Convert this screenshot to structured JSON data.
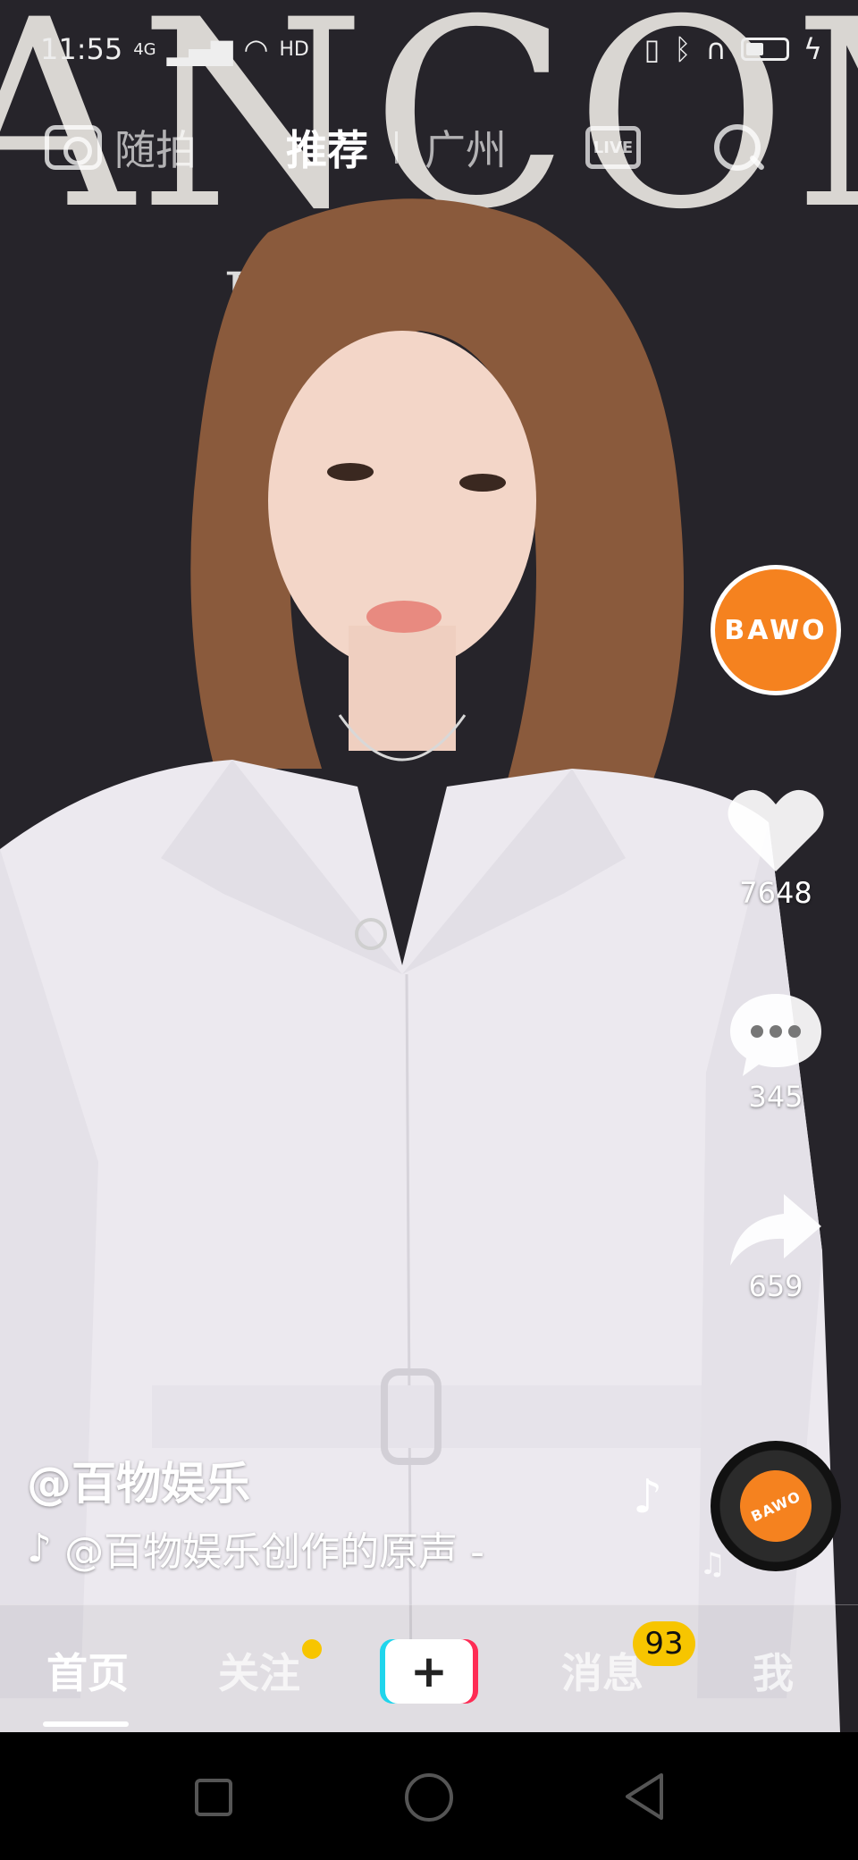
{
  "status_bar": {
    "time": "11:55",
    "network": "4G",
    "wifi_label": "HD",
    "icons": [
      "signal-icon",
      "wifi-icon",
      "vibrate-icon",
      "bluetooth-icon",
      "headphones-icon",
      "battery-icon",
      "charging-icon"
    ],
    "battery_level": 0.45
  },
  "top_nav": {
    "camera_label": "随拍",
    "tabs": [
      {
        "label": "推荐",
        "active": true
      },
      {
        "label": "广州",
        "active": false
      }
    ],
    "live_label": "LIVE"
  },
  "video": {
    "backdrop_text": "ANCÔM",
    "backdrop_sub": "F"
  },
  "rail": {
    "avatar_text": "BAWO",
    "likes": "7648",
    "comments": "345",
    "shares": "659"
  },
  "caption": {
    "author": "@百物娱乐",
    "music": "@百物娱乐创作的原声 -",
    "disc_text": "BAWO"
  },
  "tab_bar": {
    "home": "首页",
    "follow": "关注",
    "add": "+",
    "messages": "消息",
    "messages_badge": "93",
    "me": "我"
  },
  "colors": {
    "accent_orange": "#f5821f",
    "badge_yellow": "#f7c500",
    "tiktok_cyan": "#20d5ec",
    "tiktok_red": "#fe2c55"
  }
}
